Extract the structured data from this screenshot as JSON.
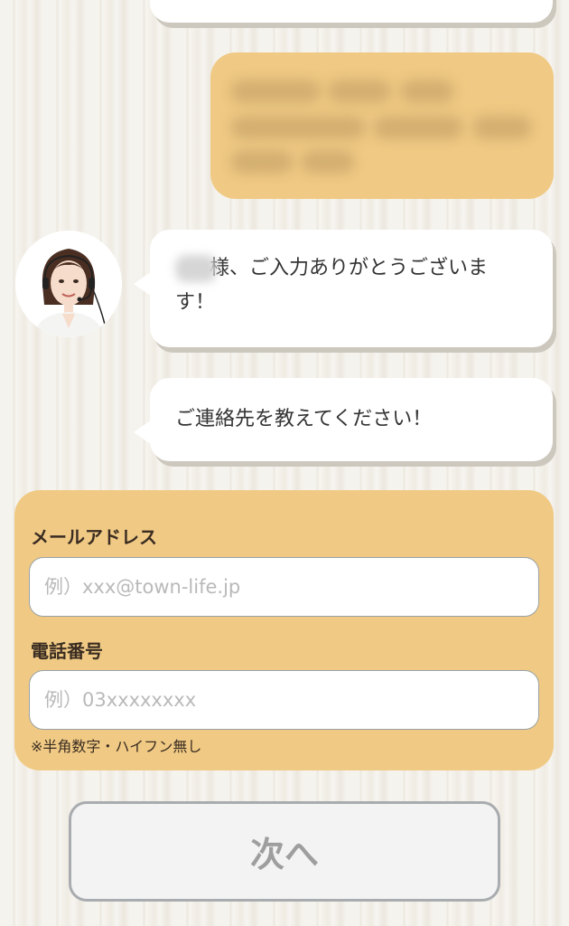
{
  "chat": {
    "message1_suffix": "様、ご入力ありがとうございます！",
    "message2": "ご連絡先を教えてください！"
  },
  "form": {
    "email_label": "メールアドレス",
    "email_placeholder": "例）xxx@town-life.jp",
    "phone_label": "電話番号",
    "phone_placeholder": "例）03xxxxxxxx",
    "phone_hint": "※半角数字・ハイフン無し"
  },
  "next_button": "次へ",
  "colors": {
    "panel": "#f0ca84",
    "bubble": "#ffffff",
    "button_text": "#9e9e9e"
  }
}
